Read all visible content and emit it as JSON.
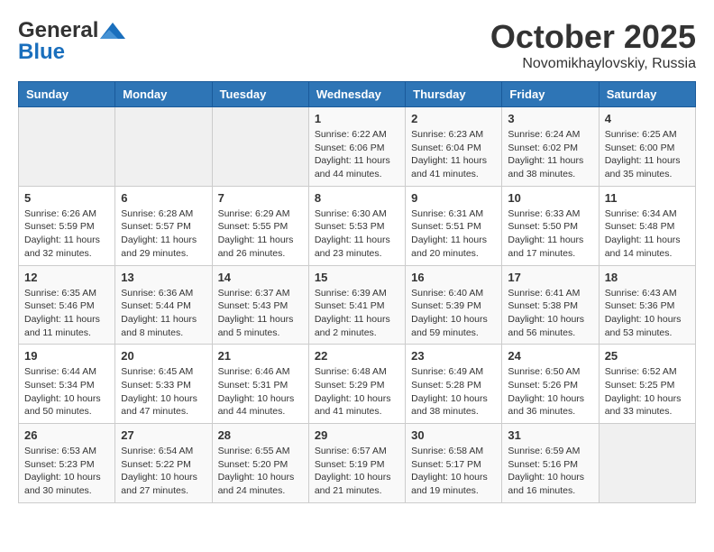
{
  "logo": {
    "general": "General",
    "blue": "Blue"
  },
  "title": "October 2025",
  "location": "Novomikhaylovskiy, Russia",
  "headers": [
    "Sunday",
    "Monday",
    "Tuesday",
    "Wednesday",
    "Thursday",
    "Friday",
    "Saturday"
  ],
  "weeks": [
    [
      {
        "day": "",
        "info": ""
      },
      {
        "day": "",
        "info": ""
      },
      {
        "day": "",
        "info": ""
      },
      {
        "day": "1",
        "info": "Sunrise: 6:22 AM\nSunset: 6:06 PM\nDaylight: 11 hours and 44 minutes."
      },
      {
        "day": "2",
        "info": "Sunrise: 6:23 AM\nSunset: 6:04 PM\nDaylight: 11 hours and 41 minutes."
      },
      {
        "day": "3",
        "info": "Sunrise: 6:24 AM\nSunset: 6:02 PM\nDaylight: 11 hours and 38 minutes."
      },
      {
        "day": "4",
        "info": "Sunrise: 6:25 AM\nSunset: 6:00 PM\nDaylight: 11 hours and 35 minutes."
      }
    ],
    [
      {
        "day": "5",
        "info": "Sunrise: 6:26 AM\nSunset: 5:59 PM\nDaylight: 11 hours and 32 minutes."
      },
      {
        "day": "6",
        "info": "Sunrise: 6:28 AM\nSunset: 5:57 PM\nDaylight: 11 hours and 29 minutes."
      },
      {
        "day": "7",
        "info": "Sunrise: 6:29 AM\nSunset: 5:55 PM\nDaylight: 11 hours and 26 minutes."
      },
      {
        "day": "8",
        "info": "Sunrise: 6:30 AM\nSunset: 5:53 PM\nDaylight: 11 hours and 23 minutes."
      },
      {
        "day": "9",
        "info": "Sunrise: 6:31 AM\nSunset: 5:51 PM\nDaylight: 11 hours and 20 minutes."
      },
      {
        "day": "10",
        "info": "Sunrise: 6:33 AM\nSunset: 5:50 PM\nDaylight: 11 hours and 17 minutes."
      },
      {
        "day": "11",
        "info": "Sunrise: 6:34 AM\nSunset: 5:48 PM\nDaylight: 11 hours and 14 minutes."
      }
    ],
    [
      {
        "day": "12",
        "info": "Sunrise: 6:35 AM\nSunset: 5:46 PM\nDaylight: 11 hours and 11 minutes."
      },
      {
        "day": "13",
        "info": "Sunrise: 6:36 AM\nSunset: 5:44 PM\nDaylight: 11 hours and 8 minutes."
      },
      {
        "day": "14",
        "info": "Sunrise: 6:37 AM\nSunset: 5:43 PM\nDaylight: 11 hours and 5 minutes."
      },
      {
        "day": "15",
        "info": "Sunrise: 6:39 AM\nSunset: 5:41 PM\nDaylight: 11 hours and 2 minutes."
      },
      {
        "day": "16",
        "info": "Sunrise: 6:40 AM\nSunset: 5:39 PM\nDaylight: 10 hours and 59 minutes."
      },
      {
        "day": "17",
        "info": "Sunrise: 6:41 AM\nSunset: 5:38 PM\nDaylight: 10 hours and 56 minutes."
      },
      {
        "day": "18",
        "info": "Sunrise: 6:43 AM\nSunset: 5:36 PM\nDaylight: 10 hours and 53 minutes."
      }
    ],
    [
      {
        "day": "19",
        "info": "Sunrise: 6:44 AM\nSunset: 5:34 PM\nDaylight: 10 hours and 50 minutes."
      },
      {
        "day": "20",
        "info": "Sunrise: 6:45 AM\nSunset: 5:33 PM\nDaylight: 10 hours and 47 minutes."
      },
      {
        "day": "21",
        "info": "Sunrise: 6:46 AM\nSunset: 5:31 PM\nDaylight: 10 hours and 44 minutes."
      },
      {
        "day": "22",
        "info": "Sunrise: 6:48 AM\nSunset: 5:29 PM\nDaylight: 10 hours and 41 minutes."
      },
      {
        "day": "23",
        "info": "Sunrise: 6:49 AM\nSunset: 5:28 PM\nDaylight: 10 hours and 38 minutes."
      },
      {
        "day": "24",
        "info": "Sunrise: 6:50 AM\nSunset: 5:26 PM\nDaylight: 10 hours and 36 minutes."
      },
      {
        "day": "25",
        "info": "Sunrise: 6:52 AM\nSunset: 5:25 PM\nDaylight: 10 hours and 33 minutes."
      }
    ],
    [
      {
        "day": "26",
        "info": "Sunrise: 6:53 AM\nSunset: 5:23 PM\nDaylight: 10 hours and 30 minutes."
      },
      {
        "day": "27",
        "info": "Sunrise: 6:54 AM\nSunset: 5:22 PM\nDaylight: 10 hours and 27 minutes."
      },
      {
        "day": "28",
        "info": "Sunrise: 6:55 AM\nSunset: 5:20 PM\nDaylight: 10 hours and 24 minutes."
      },
      {
        "day": "29",
        "info": "Sunrise: 6:57 AM\nSunset: 5:19 PM\nDaylight: 10 hours and 21 minutes."
      },
      {
        "day": "30",
        "info": "Sunrise: 6:58 AM\nSunset: 5:17 PM\nDaylight: 10 hours and 19 minutes."
      },
      {
        "day": "31",
        "info": "Sunrise: 6:59 AM\nSunset: 5:16 PM\nDaylight: 10 hours and 16 minutes."
      },
      {
        "day": "",
        "info": ""
      }
    ]
  ]
}
